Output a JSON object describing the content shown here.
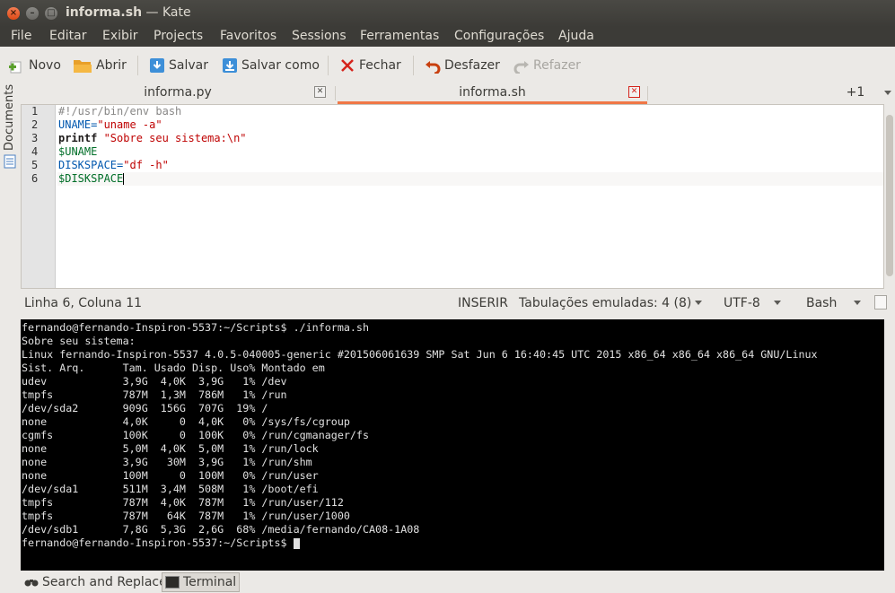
{
  "window": {
    "filename": "informa.sh",
    "app": " — Kate"
  },
  "menu": [
    "File",
    "Editar",
    "Exibir",
    "Projects",
    "Favoritos",
    "Sessions",
    "Ferramentas",
    "Configurações",
    "Ajuda"
  ],
  "toolbar": {
    "new": "Novo",
    "open": "Abrir",
    "save": "Salvar",
    "save_as": "Salvar como",
    "close": "Fechar",
    "undo": "Desfazer",
    "redo": "Refazer"
  },
  "sidebar": {
    "documents": "Documents"
  },
  "tabs": {
    "tab1": "informa.py",
    "tab2": "informa.sh",
    "more": "+1",
    "close_glyph": "✕"
  },
  "editor": {
    "line_numbers": [
      "1",
      "2",
      "3",
      "4",
      "5",
      "6"
    ],
    "line1": "#!/usr/bin/env bash",
    "line2_var": "UNAME=",
    "line2_str": "\"uname -a\"",
    "line3_kw": "printf",
    "line3_str": " \"Sobre seu sistema:\\n\"",
    "line4": "$UNAME",
    "line5_var": "DISKSPACE=",
    "line5_str": "\"df -h\"",
    "line6": "$DISKSPACE"
  },
  "status": {
    "position": "Linha 6, Coluna 11",
    "mode": "INSERIR",
    "indent": "Tabulações emuladas: 4 (8)",
    "encoding": "UTF-8",
    "syntax": "Bash"
  },
  "terminal": {
    "lines": [
      "fernando@fernando-Inspiron-5537:~/Scripts$ ./informa.sh",
      "Sobre seu sistema:",
      "Linux fernando-Inspiron-5537 4.0.5-040005-generic #201506061639 SMP Sat Jun 6 16:40:45 UTC 2015 x86_64 x86_64 x86_64 GNU/Linux",
      "Sist. Arq.      Tam. Usado Disp. Uso% Montado em",
      "udev            3,9G  4,0K  3,9G   1% /dev",
      "tmpfs           787M  1,3M  786M   1% /run",
      "/dev/sda2       909G  156G  707G  19% /",
      "none            4,0K     0  4,0K   0% /sys/fs/cgroup",
      "cgmfs           100K     0  100K   0% /run/cgmanager/fs",
      "none            5,0M  4,0K  5,0M   1% /run/lock",
      "none            3,9G   30M  3,9G   1% /run/shm",
      "none            100M     0  100M   0% /run/user",
      "/dev/sda1       511M  3,4M  508M   1% /boot/efi",
      "tmpfs           787M  4,0K  787M   1% /run/user/112",
      "tmpfs           787M   64K  787M   1% /run/user/1000",
      "/dev/sdb1       7,8G  5,3G  2,6G  68% /media/fernando/CA08-1A08"
    ],
    "prompt": "fernando@fernando-Inspiron-5537:~/Scripts$ "
  },
  "bottom_tabs": {
    "search": "Search and Replace",
    "terminal": "Terminal"
  }
}
